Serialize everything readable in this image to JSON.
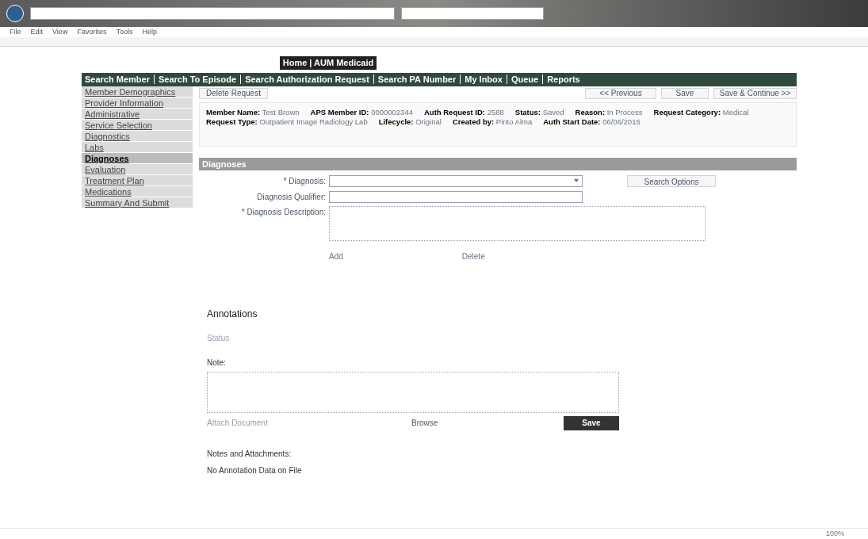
{
  "browser": {
    "menu": [
      "File",
      "Edit",
      "View",
      "Favorites",
      "Tools",
      "Help"
    ],
    "zoom": "100%"
  },
  "page_title": "Home | AUM Medicaid",
  "nav": [
    "Search Member",
    "Search To Episode",
    "Search Authorization Request",
    "Search PA Number",
    "My Inbox",
    "Queue",
    "Reports"
  ],
  "sidebar": [
    {
      "label": "Member Demographics",
      "selected": false
    },
    {
      "label": "Provider Information",
      "selected": false
    },
    {
      "label": "Administrative",
      "selected": false
    },
    {
      "label": "Service Selection",
      "selected": false
    },
    {
      "label": "Diagnostics",
      "selected": false
    },
    {
      "label": "Labs",
      "selected": false
    },
    {
      "label": "Diagnoses",
      "selected": true
    },
    {
      "label": "Evaluation",
      "selected": false
    },
    {
      "label": "Treatment Plan",
      "selected": false
    },
    {
      "label": "Medications",
      "selected": false
    },
    {
      "label": "Summary And Submit",
      "selected": false
    }
  ],
  "actions": {
    "delete": "Delete Request",
    "previous": "<< Previous",
    "save": "Save",
    "save_continue": "Save & Continue >>"
  },
  "summary": [
    {
      "label": "Member Name:",
      "value": "Test Brown"
    },
    {
      "label": "APS Member ID:",
      "value": "0000002344"
    },
    {
      "label": "Auth Request ID:",
      "value": "2588"
    },
    {
      "label": "Status:",
      "value": "Saved"
    },
    {
      "label": "Reason:",
      "value": "In Process"
    },
    {
      "label": "Request Category:",
      "value": "Medical"
    },
    {
      "label": "Request Type:",
      "value": "Outpatient Image Radiology Lab"
    },
    {
      "label": "Lifecycle:",
      "value": "Original"
    },
    {
      "label": "Created by:",
      "value": "Pinto Alma"
    },
    {
      "label": "Auth Start Date:",
      "value": "06/06/2016"
    }
  ],
  "section": "Diagnoses",
  "form": {
    "diagnosis": "* Diagnosis:",
    "qualifier": "Diagnosis Qualifier:",
    "description": "* Diagnosis Description:",
    "search": "Search Options",
    "add": "Add",
    "delete": "Delete"
  },
  "annotations": {
    "title": "Annotations",
    "status": "Status",
    "note": "Note:",
    "attach": "Attach Document",
    "browse": "Browse",
    "save": "Save",
    "list_title": "Notes and Attachments:",
    "empty": "No Annotation Data on File"
  }
}
